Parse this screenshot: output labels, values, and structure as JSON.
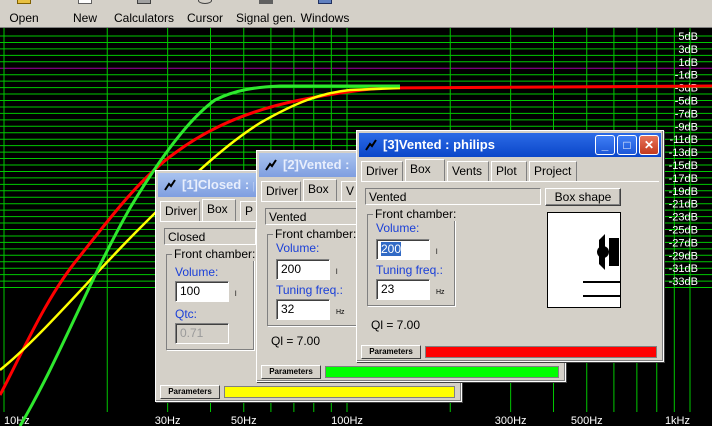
{
  "toolbar": {
    "items": [
      {
        "label": "Open",
        "icon": "open-folder-icon"
      },
      {
        "label": "New",
        "icon": "new-document-icon"
      },
      {
        "label": "Calculators",
        "icon": "calculator-icon"
      },
      {
        "label": "Cursor",
        "icon": "cursor-icon"
      },
      {
        "label": "Signal gen.",
        "icon": "signal-generator-icon"
      },
      {
        "label": "Windows",
        "icon": "windows-icon"
      }
    ]
  },
  "graph": {
    "y_ticks": [
      "5dB",
      "3dB",
      "1dB",
      "-1dB",
      "-3dB",
      "-5dB",
      "-7dB",
      "-9dB",
      "-11dB",
      "-13dB",
      "-15dB",
      "-17dB",
      "-19dB",
      "-21dB",
      "-23dB",
      "-25dB",
      "-27dB",
      "-29dB",
      "-31dB",
      "-33dB"
    ],
    "x_ticks": [
      "10Hz",
      "30Hz",
      "50Hz",
      "100Hz",
      "300Hz",
      "500Hz",
      "1kHz"
    ],
    "colors": {
      "background": "#000000",
      "grid": "#00c800",
      "grid_highlight": "#a000a0",
      "curve_red": "#ff0000",
      "curve_green": "#2ee82e",
      "curve_yellow": "#ffff00"
    }
  },
  "windows": {
    "closed": {
      "title": "[1]Closed : p",
      "tabs": [
        "Driver",
        "Box",
        "P"
      ],
      "box_type": "Closed",
      "group_caption": "Front chamber:",
      "volume_label": "Volume:",
      "volume_value": "100",
      "volume_unit": "l",
      "qtc_label": "Qtc:",
      "qtc_value": "0.71",
      "params_label": "Parameters",
      "bar_color": "#ffff00"
    },
    "vented2": {
      "title": "[2]Vented :",
      "tabs": [
        "Driver",
        "Box",
        "V"
      ],
      "box_type": "Vented",
      "group_caption": "Front chamber:",
      "volume_label": "Volume:",
      "volume_value": "200",
      "volume_unit": "l",
      "tuning_label": "Tuning freq.:",
      "tuning_value": "32",
      "tuning_unit": "Hz",
      "ql_text": "Ql = 7.00",
      "params_label": "Parameters",
      "bar_color": "#00ff00"
    },
    "vented3": {
      "title": "[3]Vented : philips",
      "tabs": [
        "Driver",
        "Box",
        "Vents",
        "Plot",
        "Project"
      ],
      "box_type": "Vented",
      "box_shape_button": "Box shape",
      "group_caption": "Front chamber:",
      "volume_label": "Volume:",
      "volume_value": "200",
      "volume_unit": "l",
      "tuning_label": "Tuning freq.:",
      "tuning_value": "23",
      "tuning_unit": "Hz",
      "ql_text": "Ql = 7.00",
      "params_label": "Parameters",
      "bar_color": "#ff0000"
    }
  }
}
